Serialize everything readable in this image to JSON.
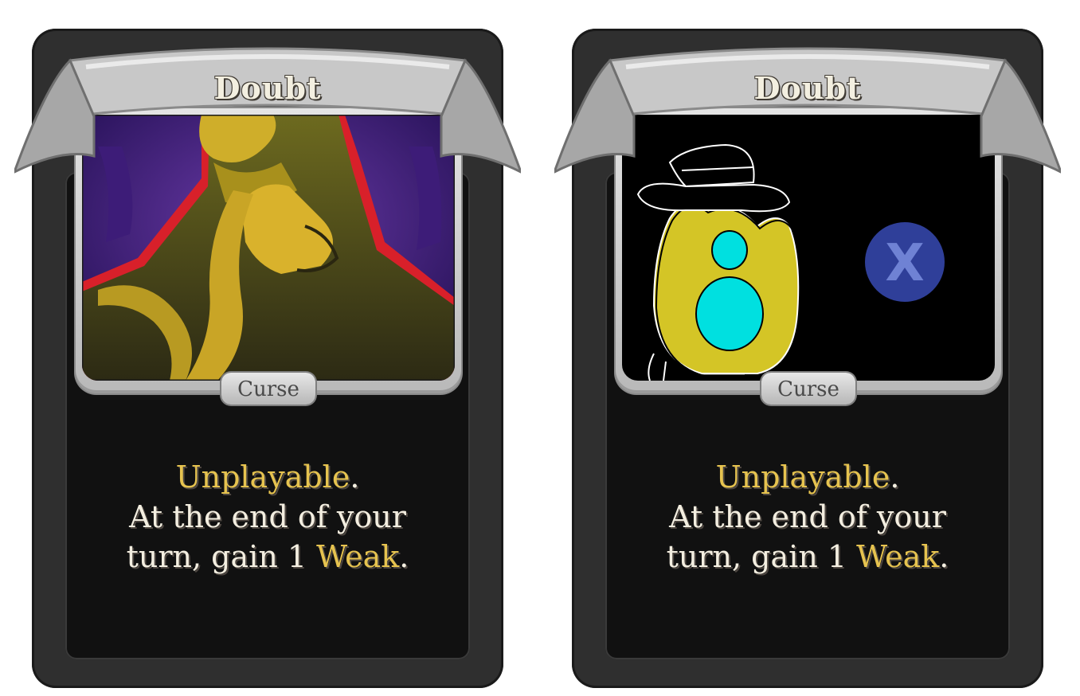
{
  "cards": [
    {
      "title": "Doubt",
      "type": "Curse",
      "description": {
        "line1_keyword": "Unplayable",
        "line1_end": ".",
        "line2": "At the end of your",
        "line3_start": "turn, gain 1 ",
        "line3_keyword": "Weak",
        "line3_end": "."
      },
      "art": "shadowy-figure-art"
    },
    {
      "title": "Doubt",
      "type": "Curse",
      "description": {
        "line1_keyword": "Unplayable",
        "line1_end": ".",
        "line2": "At the end of your",
        "line3_start": "turn, gain 1 ",
        "line3_keyword": "Weak",
        "line3_end": "."
      },
      "art": "hand-drawn-character-art",
      "art_glyph": "X"
    }
  ],
  "colors": {
    "card_body": "#2f2f2f",
    "keyword": "#e6c34f",
    "text": "#f3eee0",
    "frame": "#c8c8c8"
  }
}
